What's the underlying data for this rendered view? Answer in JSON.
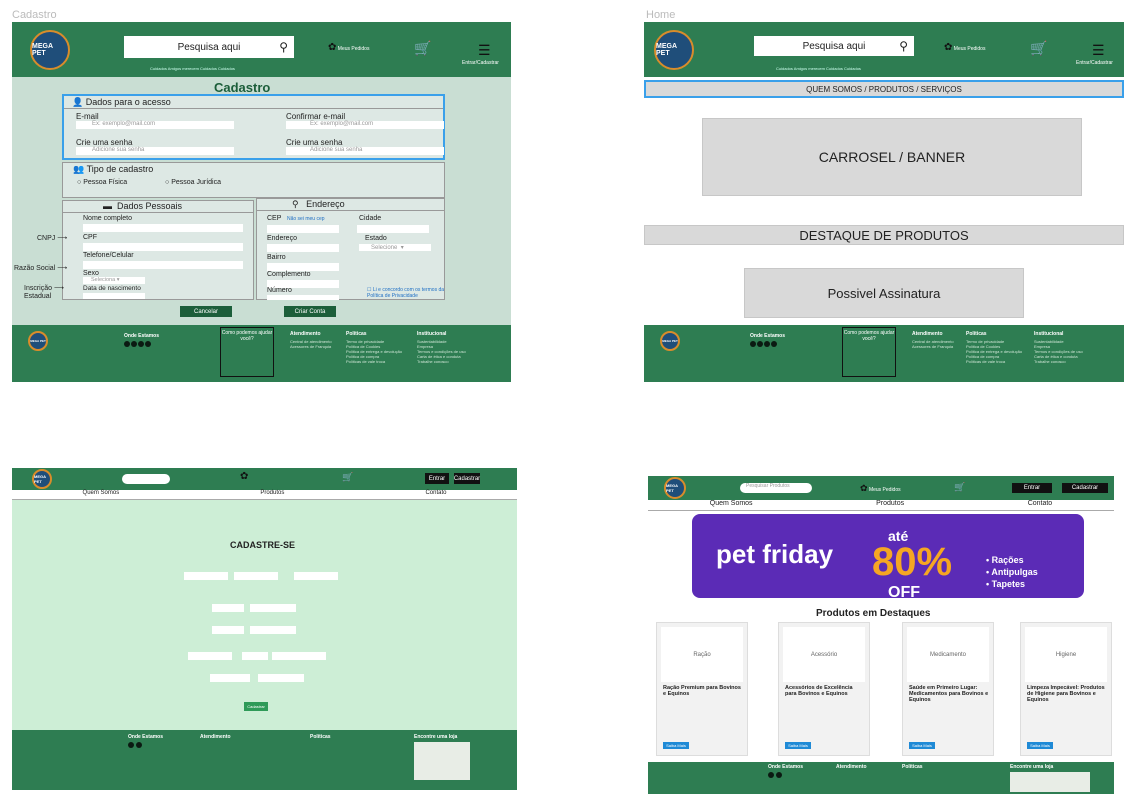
{
  "cadastro": {
    "frame_title": "Cadastro",
    "logo": "MEGA PET",
    "search_placeholder": "Pesquisa aqui",
    "tagline": "Cuidados Amigos merecem Cuidados Cuidados",
    "orders": "Meus Pedidos",
    "login": "Entrar/Cadastrar",
    "title": "Cadastro",
    "access_title": "Dados para o acesso",
    "email": "E-mail",
    "email_ph": "Ex: exemplo@mail.com",
    "confirm_email": "Confirmar e-mail",
    "confirm_email_ph": "Ex: exemplo@mail.com",
    "password": "Crie uma senha",
    "password_ph": "Adicione sua senha",
    "password2": "Crie uma senha",
    "password2_ph": "Adicione sua senha",
    "type_title": "Tipo de cadastro",
    "pf": "Pessoa Física",
    "pj": "Pessoa Jurídica",
    "personal_title": "Dados Pessoais",
    "name": "Nome completo",
    "cpf": "CPF",
    "phone": "Telefone/Celular",
    "sex": "Sexo",
    "sex_select": "Seleciona",
    "birth": "Data de nascimento",
    "address_title": "Endereço",
    "cep": "CEP",
    "cep_link": "Não sei meu cep",
    "city": "Cidade",
    "street": "Endereço",
    "state": "Estado",
    "state_select": "Selecione",
    "district": "Bairro",
    "complement": "Complemento",
    "number": "Número",
    "terms": "Li e concordo com os termos da Política de Privacidade",
    "cancel": "Cancelar",
    "create": "Criar Conta",
    "ann_cnpj": "CNPJ",
    "ann_razao": "Razão Social",
    "ann_inscr1": "Inscrição",
    "ann_inscr2": "Estadual"
  },
  "home": {
    "frame_title": "Home",
    "logo": "MEGA PET",
    "search_placeholder": "Pesquisa aqui",
    "tagline": "Cuidados Amigos merecem Cuidados Cuidados",
    "orders": "Meus Pedidos",
    "login": "Entrar/Cadastrar",
    "nav": "QUEM SOMOS / PRODUTOS / SERVIÇOS",
    "banner": "CARROSEL / BANNER",
    "highlight": "DESTAQUE DE PRODUTOS",
    "subscription": "Possivel Assinatura"
  },
  "footer": {
    "follow": "Onde Estamos",
    "question": "Como podemos ajudar você?",
    "atend": "Atendimento",
    "atend_items": [
      "Central de atendimento",
      "Acessores de Franquia"
    ],
    "pol": "Politicas",
    "pol_items": [
      "Termo de privacidade",
      "Política de Cookies",
      "Política de entrega e devolução",
      "Política de compra",
      "Políticas de vale troca"
    ],
    "inst": "Institucional",
    "inst_items": [
      "Sustentabilidade",
      "Empresa",
      "Termos e condições de uso",
      "Carta de ética e conduta",
      "Trabalhe conosco"
    ]
  },
  "cad2": {
    "title": "CADASTRE-SE",
    "nav": [
      "Quem Somos",
      "Produtos",
      "Contato"
    ],
    "login": "Entrar",
    "register": "Cadastrar",
    "submit": "Cadastrar"
  },
  "home2": {
    "logo": "MEGA PET",
    "search_placeholder": "Pesquisar Produtos",
    "orders": "Meus Pedidos",
    "login": "Entrar",
    "register": "Cadastrar",
    "nav": [
      "Quem Somos",
      "Produtos",
      "Contato"
    ],
    "banner_left": "pet friday",
    "banner_ate": "até",
    "banner_pct": "80%",
    "banner_off": "OFF",
    "banner_items": [
      "• Rações",
      "• Antipulgas",
      "• Tapetes"
    ],
    "section_title": "Produtos em Destaques",
    "cards": [
      {
        "title": "Ração Premium para Bovinos e Equinos",
        "img": "Ração",
        "btn": "Saiba Mais"
      },
      {
        "title": "Acessórios de Excelência para Bovinos e Equinos",
        "img": "Acessório",
        "btn": "Saiba Mais"
      },
      {
        "title": "Saúde em Primeiro Lugar: Medicamentos para Bovinos e Equinos",
        "img": "Medicamento",
        "btn": "Saiba Mais"
      },
      {
        "title": "Limpeza Impecável: Produtos de Higiene para Bovinos e Equinos",
        "img": "Higiene",
        "btn": "Saiba Mais"
      }
    ],
    "f_where": "Onde Estamos",
    "f_atend": "Atendimento",
    "f_pol": "Políticas",
    "f_store": "Encontre uma loja"
  }
}
